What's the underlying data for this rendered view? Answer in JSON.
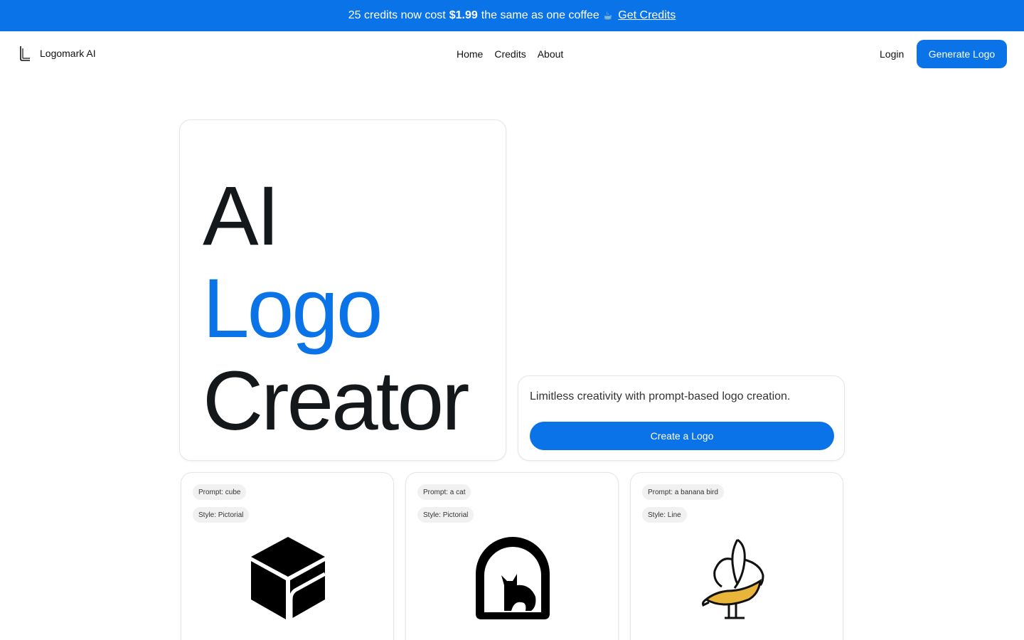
{
  "banner": {
    "text_before": "25 credits now cost",
    "price": "$1.99",
    "text_after": "the same as one coffee",
    "coffee_icon": "☕",
    "link": "Get Credits"
  },
  "nav": {
    "brand": "Logomark AI",
    "brand_icon": "logomark-icon",
    "links": [
      "Home",
      "Credits",
      "About"
    ],
    "login": "Login",
    "cta": "Generate Logo"
  },
  "hero": {
    "line1": "AI",
    "line2": "Logo",
    "line3": "Creator"
  },
  "cta_card": {
    "text": "Limitless creativity with prompt-based logo creation.",
    "button": "Create a Logo"
  },
  "examples": [
    {
      "prompt": "Prompt: cube",
      "style": "Style: Pictorial",
      "icon": "cube-logo-icon"
    },
    {
      "prompt": "Prompt: a cat",
      "style": "Style: Pictorial",
      "icon": "cat-arch-logo-icon"
    },
    {
      "prompt": "Prompt: a banana bird",
      "style": "Style: Line",
      "icon": "banana-bird-logo-icon"
    }
  ],
  "colors": {
    "accent": "#0a73e8",
    "text": "#14181b",
    "banana_fill": "#e8b43a"
  }
}
